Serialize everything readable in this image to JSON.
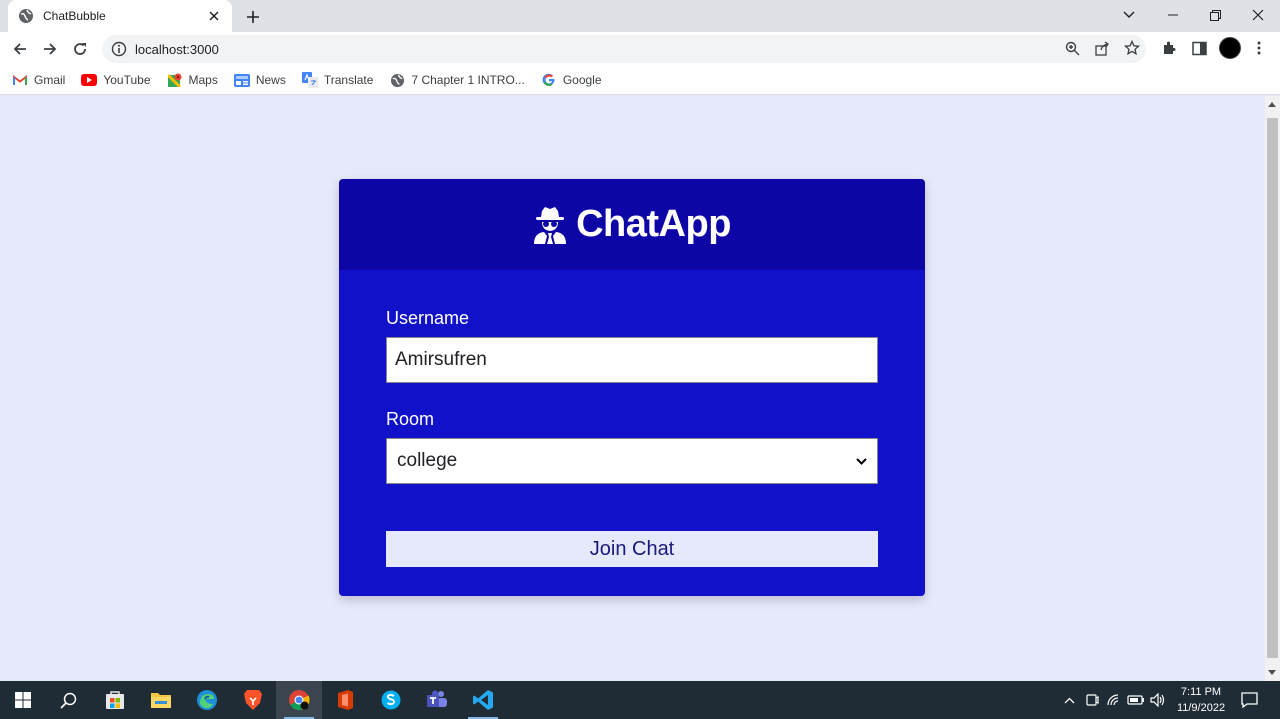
{
  "browser": {
    "tab": {
      "title": "ChatBubble",
      "favicon": "globe-icon"
    },
    "address": {
      "url": "localhost:3000"
    },
    "bookmarks": [
      {
        "label": "Gmail",
        "icon": "gmail-icon"
      },
      {
        "label": "YouTube",
        "icon": "youtube-icon"
      },
      {
        "label": "Maps",
        "icon": "maps-icon"
      },
      {
        "label": "News",
        "icon": "news-icon"
      },
      {
        "label": "Translate",
        "icon": "translate-icon"
      },
      {
        "label": "7 Chapter 1 INTRO...",
        "icon": "globe-icon"
      },
      {
        "label": "Google",
        "icon": "google-icon"
      }
    ]
  },
  "app": {
    "title": "ChatApp",
    "logo_icon": "user-secret-icon",
    "colors": {
      "header": "#0e05a6",
      "body": "#1111c9",
      "page_bg": "#e6e8fb"
    },
    "form": {
      "username_label": "Username",
      "username_value": "Amirsufren",
      "room_label": "Room",
      "room_selected": "college",
      "join_label": "Join Chat"
    }
  },
  "taskbar": {
    "time": "7:11 PM",
    "date": "11/9/2022",
    "apps": [
      "start",
      "search",
      "store",
      "file-explorer",
      "edge",
      "brave",
      "chrome",
      "office",
      "skype",
      "teams",
      "vscode"
    ]
  }
}
